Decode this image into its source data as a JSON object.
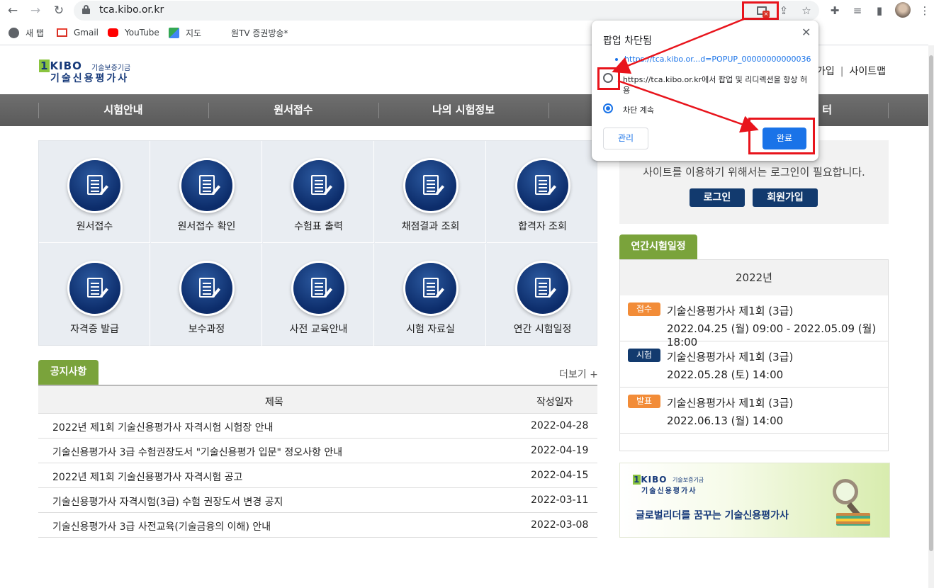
{
  "browser": {
    "url": "tca.kibo.or.kr",
    "bookmarks": [
      {
        "label": "새 탭"
      },
      {
        "label": "Gmail"
      },
      {
        "label": "YouTube"
      },
      {
        "label": "지도"
      },
      {
        "label": "원TV 증권방송*"
      }
    ]
  },
  "popup": {
    "title": "팝업 차단됨",
    "blocked_link": "https://tca.kibo.or...d=POPUP_00000000000036",
    "option_allow": "https://tca.kibo.or.kr에서 팝업 및 리디렉션을 항상 허용",
    "option_block": "차단 계속",
    "manage_label": "관리",
    "done_label": "완료",
    "highlight_color": "#e8141c"
  },
  "header": {
    "logo_mark": "KIBO",
    "logo_sub": "기술보증기금",
    "logo_name": "기술신용평가사",
    "links": [
      "가입",
      "사이트맵"
    ]
  },
  "gnb": {
    "items": [
      "시험안내",
      "원서접수",
      "나의 시험정보",
      "",
      "터"
    ]
  },
  "quick": {
    "items": [
      "원서접수",
      "원서접수 확인",
      "수험표 출력",
      "채점결과 조회",
      "합격자 조회",
      "자격증 발급",
      "보수과정",
      "사전 교육안내",
      "시험 자료실",
      "연간 시험일정"
    ]
  },
  "notice": {
    "tab": "공지사항",
    "more": "더보기 +",
    "col_title": "제목",
    "col_date": "작성일자",
    "rows": [
      {
        "title": "2022년 제1회 기술신용평가사 자격시험 시험장 안내",
        "date": "2022-04-28"
      },
      {
        "title": "기술신용평가사 3급 수험권장도서 \"기술신용평가 입문\" 정오사항 안내",
        "date": "2022-04-19"
      },
      {
        "title": "2022년 제1회 기술신용평가사 자격시험 공고",
        "date": "2022-04-15"
      },
      {
        "title": "기술신용평가사 자격시험(3급) 수험 권장도서 변경 공지",
        "date": "2022-03-11"
      },
      {
        "title": "기술신용평가사 3급 사전교육(기술금융의 이해) 안내",
        "date": "2022-03-08"
      }
    ]
  },
  "login": {
    "message": "사이트를 이용하기 위해서는 로그인이 필요합니다.",
    "login_label": "로그인",
    "join_label": "회원가입"
  },
  "schedule": {
    "tab": "연간시험일정",
    "year": "2022년",
    "events": [
      {
        "badge": "접수",
        "badge_color": "#f28c38",
        "title": "기술신용평가사 제1회 (3급)",
        "date": "2022.04.25 (월) 09:00 - 2022.05.09 (월) 18:00"
      },
      {
        "badge": "시험",
        "badge_color": "#123a6e",
        "title": "기술신용평가사 제1회 (3급)",
        "date": "2022.05.28 (토) 14:00"
      },
      {
        "badge": "발표",
        "badge_color": "#f28c38",
        "title": "기술신용평가사 제1회 (3급)",
        "date": "2022.06.13 (월) 14:00"
      }
    ]
  },
  "banner": {
    "mark": "KIBO",
    "sub": "기술보증기금",
    "name": "기술신용평가사",
    "slogan": "글로벌리더를 꿈꾸는 기술신용평가사"
  }
}
